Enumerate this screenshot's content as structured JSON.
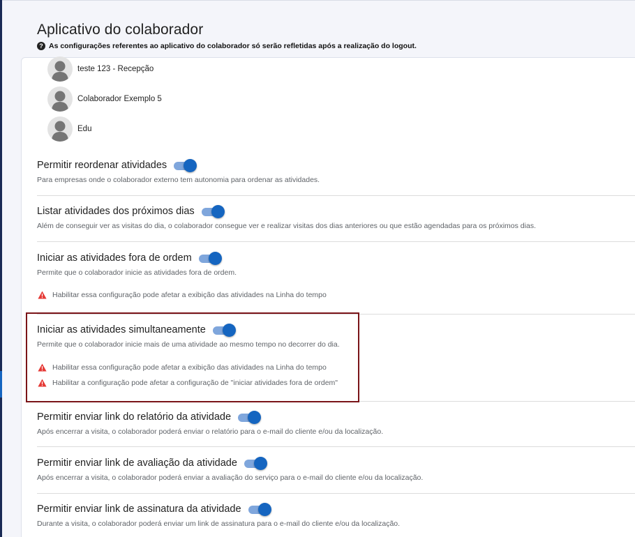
{
  "page": {
    "title": "Aplicativo do colaborador",
    "notice": "As configurações referentes ao aplicativo do colaborador só serão refletidas após a realização do logout."
  },
  "users": [
    {
      "name": "teste 123 - Recepção"
    },
    {
      "name": "Colaborador Exemplo 5"
    },
    {
      "name": "Edu"
    }
  ],
  "settings": [
    {
      "title": "Permitir reordenar atividades",
      "description": "Para empresas onde o colaborador externo tem autonomia para ordenar as atividades.",
      "enabled": true,
      "warnings": []
    },
    {
      "title": "Listar atividades dos próximos dias",
      "description": "Além de conseguir ver as visitas do dia, o colaborador consegue ver e realizar visitas dos dias anteriores ou que estão agendadas para os próximos dias.",
      "enabled": true,
      "warnings": []
    },
    {
      "title": "Iniciar as atividades fora de ordem",
      "description": "Permite que o colaborador inicie as atividades fora de ordem.",
      "enabled": true,
      "warnings": [
        "Habilitar essa configuração pode afetar a exibição das atividades na Linha do tempo"
      ]
    },
    {
      "title": "Iniciar as atividades simultaneamente",
      "description": "Permite que o colaborador inicie mais de uma atividade ao mesmo tempo no decorrer do dia.",
      "enabled": true,
      "warnings": [
        "Habilitar essa configuração pode afetar a exibição das atividades na Linha do tempo",
        "Habilitar a configuração pode afetar a configuração de \"iniciar atividades fora de ordem\""
      ]
    },
    {
      "title": "Permitir enviar link do relatório da atividade",
      "description": "Após encerrar a visita, o colaborador poderá enviar o relatório para o e-mail do cliente e/ou da localização.",
      "enabled": true,
      "warnings": []
    },
    {
      "title": "Permitir enviar link de avaliação da atividade",
      "description": "Após encerrar a visita, o colaborador poderá enviar a avaliação do serviço para o e-mail do cliente e/ou da localização.",
      "enabled": true,
      "warnings": []
    },
    {
      "title": "Permitir enviar link de assinatura da atividade",
      "description": "Durante a visita, o colaborador poderá enviar um link de assinatura para o e-mail do cliente e/ou da localização.",
      "enabled": true,
      "warnings": []
    }
  ],
  "colors": {
    "toggle_on": "#1565c0",
    "toggle_track": "#7fa6dc",
    "warning": "#e53935",
    "highlight_border": "#7a1418"
  },
  "icons": {
    "notice": "help-circle-icon",
    "avatar": "user-avatar-icon",
    "warning": "warning-triangle-icon"
  }
}
